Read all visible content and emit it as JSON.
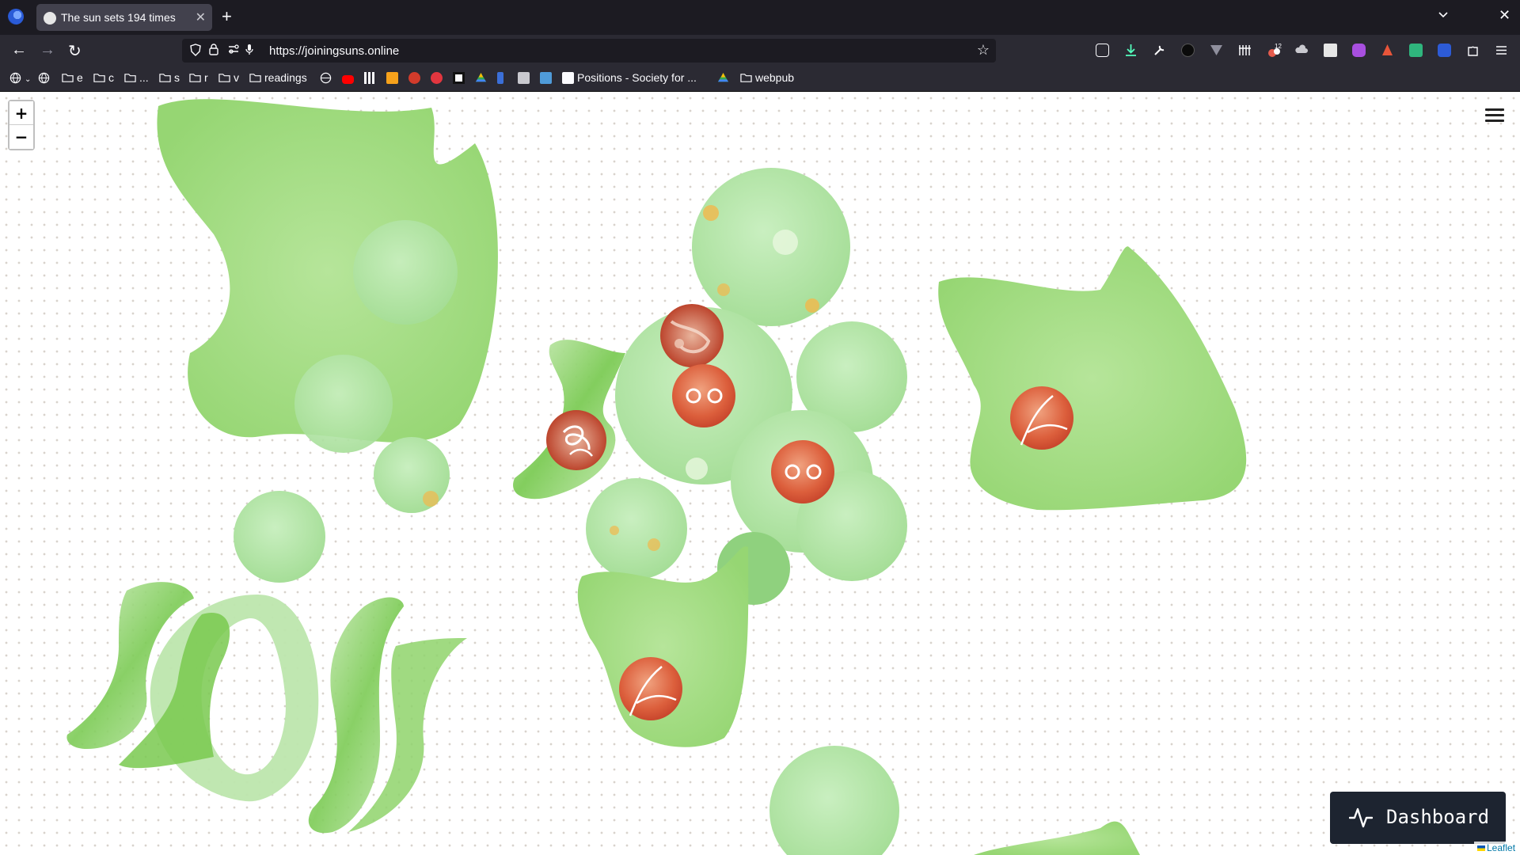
{
  "browser": {
    "tab_title": "The sun sets 194 times",
    "tab_close_glyph": "✕",
    "new_tab_glyph": "+",
    "url": "https://joiningsuns.online",
    "window_close_glyph": "✕",
    "tab_list_glyph": "⌄",
    "nav": {
      "back": "←",
      "forward": "→",
      "reload": "↻"
    },
    "star_glyph": "☆",
    "extension_badges": {
      "puzzle_count": "12"
    },
    "bookmarks": [
      {
        "label": "",
        "icon": "globe-icon"
      },
      {
        "label": "",
        "icon": "globe-icon"
      },
      {
        "label": "e",
        "icon": "folder-icon"
      },
      {
        "label": "c",
        "icon": "folder-icon"
      },
      {
        "label": "...",
        "icon": "folder-icon"
      },
      {
        "label": "s",
        "icon": "folder-icon"
      },
      {
        "label": "r",
        "icon": "folder-icon"
      },
      {
        "label": "v",
        "icon": "folder-icon"
      },
      {
        "label": "readings",
        "icon": "folder-icon"
      },
      {
        "label": "Positions - Society for ...",
        "icon": "site-icon"
      },
      {
        "label": "webpub",
        "icon": "folder-icon"
      }
    ]
  },
  "map": {
    "zoom_in": "+",
    "zoom_out": "−",
    "menu_icon": "hamburger-menu-icon",
    "dashboard_label": "Dashboard",
    "dashboard_icon": "activity-pulse-icon",
    "attribution": "Leaflet",
    "colors": {
      "green_light": "#a9df8a",
      "green_mid": "#8fd36b",
      "green_soft": "#bfe8b6",
      "sun_red": "#d2452a",
      "sun_orange": "#e8764f"
    }
  }
}
